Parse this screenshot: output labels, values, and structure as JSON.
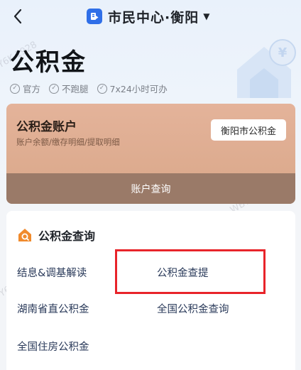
{
  "header": {
    "title": "市民中心·衡阳",
    "back_icon": "chevron-left-icon",
    "caret": "▼",
    "logo_icon": "app-logo-icon",
    "logo_color": "#2f6fe8"
  },
  "hero": {
    "title": "公积金",
    "badges": [
      {
        "icon": "check-circle-icon",
        "label": "官方"
      },
      {
        "icon": "check-circle-icon",
        "label": "不跑腿"
      },
      {
        "icon": "check-circle-icon",
        "label": "7x24小时可办"
      }
    ]
  },
  "account": {
    "title": "公积金账户",
    "subtitle": "账户余额/缴存明细/提取明细",
    "city_button": "衡阳市公积金",
    "query_button": "账户查询",
    "card_color": "#e4b39a",
    "bar_color": "#9a7a68"
  },
  "query": {
    "title": "公积金查询",
    "title_icon": "house-search-icon",
    "items": [
      {
        "label": "结息&调基解读"
      },
      {
        "label": "公积金查提"
      },
      {
        "label": "湖南省直公积金"
      },
      {
        "label": "全国公积金查询"
      },
      {
        "label": "全国住房公积金"
      }
    ],
    "highlight_color": "#e8242a"
  },
  "watermarks": [
    "Y6K-1928",
    "WB7Y6K",
    "Y6K-1928",
    "WB7Y6K-1"
  ]
}
